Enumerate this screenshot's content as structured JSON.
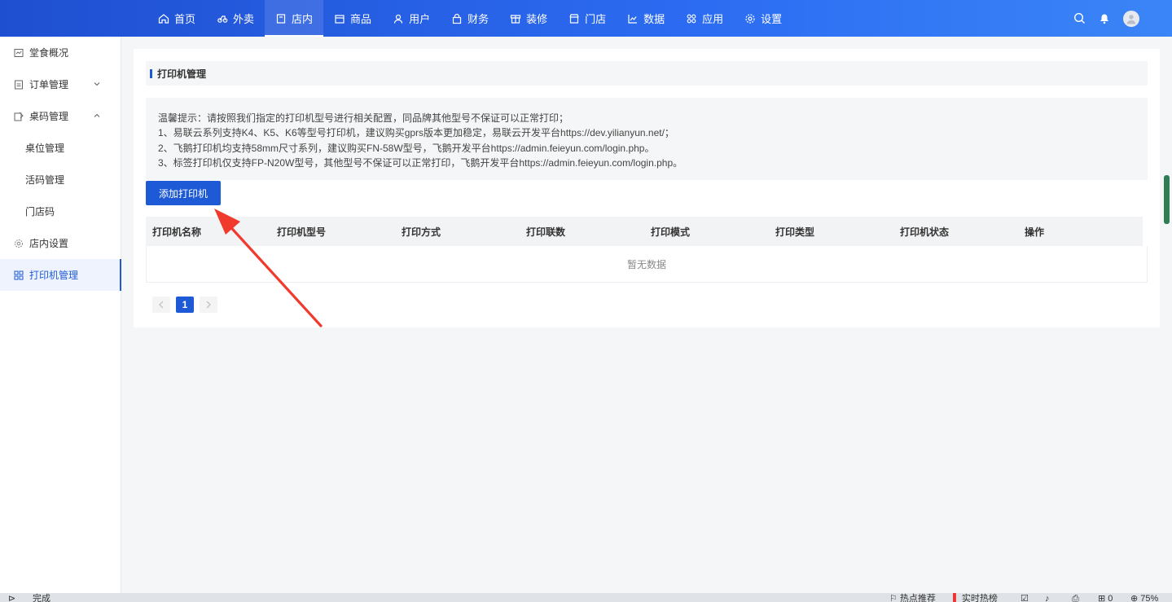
{
  "nav": {
    "items": [
      {
        "label": "首页",
        "icon": "home-icon"
      },
      {
        "label": "外卖",
        "icon": "takeout-icon"
      },
      {
        "label": "店内",
        "icon": "store-in-icon",
        "active": true
      },
      {
        "label": "商品",
        "icon": "goods-icon"
      },
      {
        "label": "用户",
        "icon": "user-icon"
      },
      {
        "label": "财务",
        "icon": "finance-icon"
      },
      {
        "label": "装修",
        "icon": "decorate-icon"
      },
      {
        "label": "门店",
        "icon": "shop-icon"
      },
      {
        "label": "数据",
        "icon": "chart-icon"
      },
      {
        "label": "应用",
        "icon": "apps-icon"
      },
      {
        "label": "设置",
        "icon": "gear-icon"
      }
    ]
  },
  "sidebar": {
    "items": [
      {
        "label": "堂食概况"
      },
      {
        "label": "订单管理"
      },
      {
        "label": "桌码管理"
      },
      {
        "label": "桌位管理"
      },
      {
        "label": "活码管理"
      },
      {
        "label": "门店码"
      },
      {
        "label": "店内设置"
      },
      {
        "label": "打印机管理"
      }
    ]
  },
  "panel": {
    "title": "打印机管理",
    "notice": [
      "温馨提示：请按照我们指定的打印机型号进行相关配置，同品牌其他型号不保证可以正常打印；",
      "1、易联云系列支持K4、K5、K6等型号打印机，建议购买gprs版本更加稳定，易联云开发平台https://dev.yilianyun.net/；",
      "2、飞鹅打印机均支持58mm尺寸系列，建议购买FN-58W型号，飞鹅开发平台https://admin.feieyun.com/login.php。",
      "3、标签打印机仅支持FP-N20W型号，其他型号不保证可以正常打印，飞鹅开发平台https://admin.feieyun.com/login.php。"
    ],
    "add_button": "添加打印机",
    "columns": [
      "打印机名称",
      "打印机型号",
      "打印方式",
      "打印联数",
      "打印模式",
      "打印类型",
      "打印机状态",
      "操作"
    ],
    "empty_text": "暂无数据",
    "pagination": {
      "current": "1"
    }
  },
  "statusbar": {
    "left_text": "完成",
    "hot": "热点推荐",
    "realtime": "实时热榜",
    "count": "0",
    "zoom": "75%"
  },
  "colors": {
    "primary": "#1f5ad6",
    "arrow": "#f03a2e"
  }
}
